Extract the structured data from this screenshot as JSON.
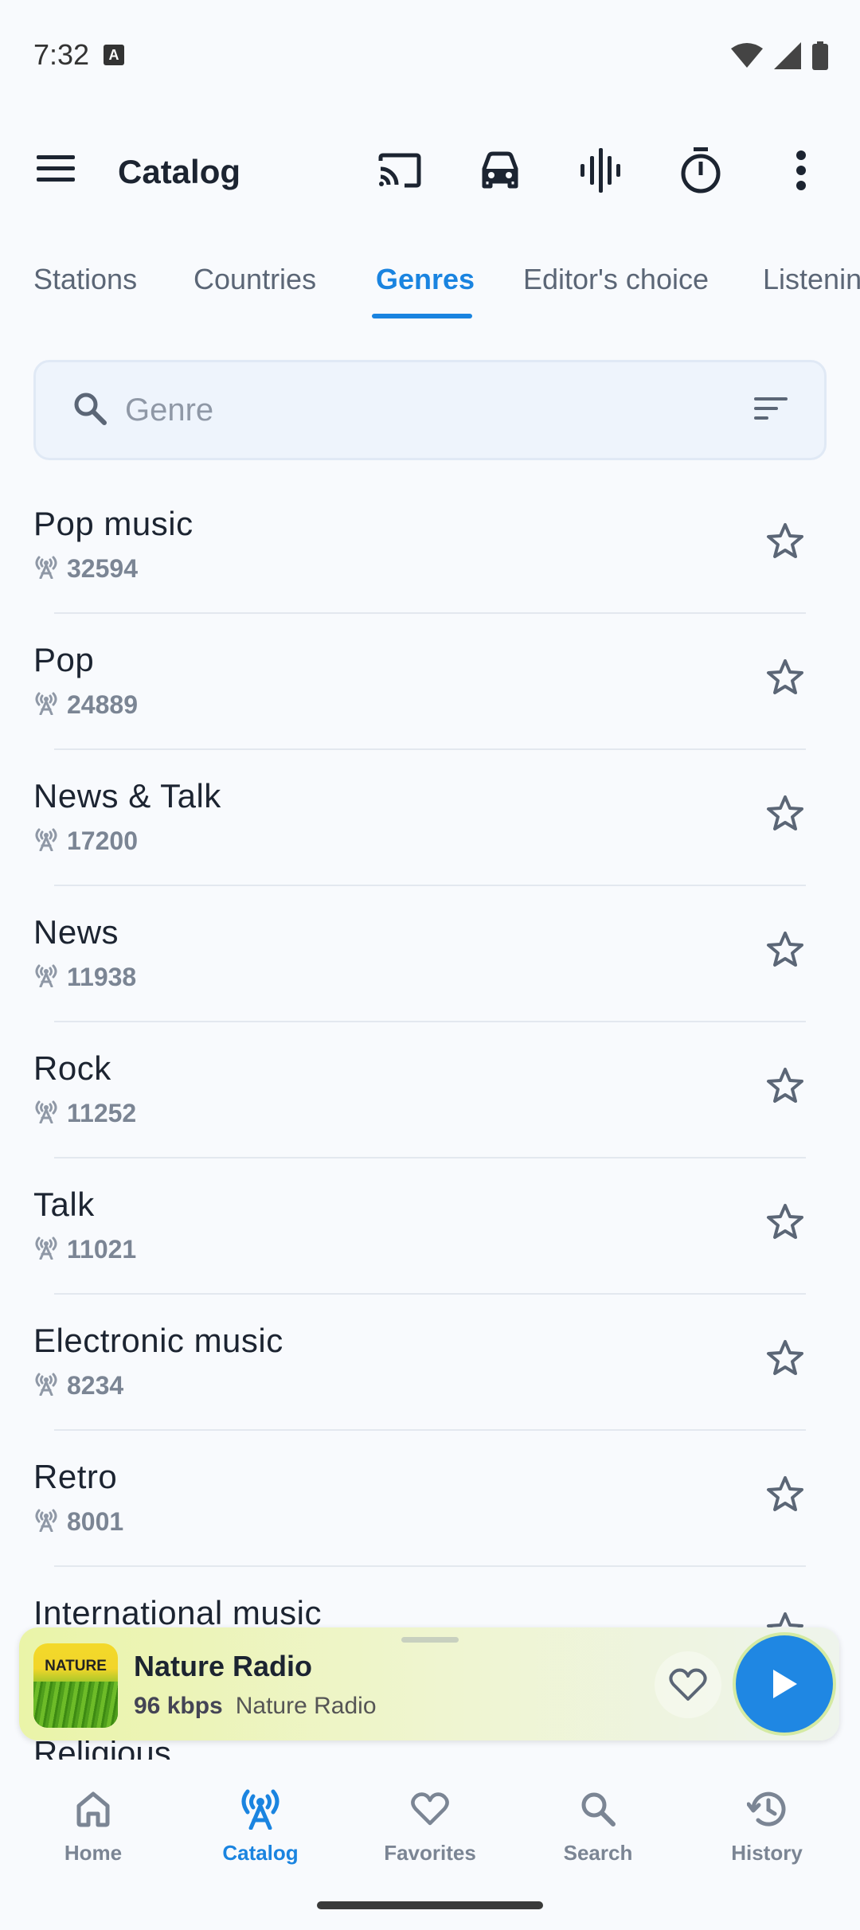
{
  "status_bar": {
    "time": "7:32",
    "badge": "A"
  },
  "toolbar": {
    "title": "Catalog",
    "icons": [
      "menu-icon",
      "cast-icon",
      "car-icon",
      "waveform-icon",
      "timer-icon",
      "more-vert-icon"
    ]
  },
  "tabs": [
    {
      "label": "Stations",
      "active": false
    },
    {
      "label": "Countries",
      "active": false
    },
    {
      "label": "Genres",
      "active": true
    },
    {
      "label": "Editor's choice",
      "active": false
    },
    {
      "label": "Listening",
      "active": false
    }
  ],
  "search": {
    "placeholder": "Genre",
    "value": ""
  },
  "genres": [
    {
      "name": "Pop music",
      "count": "32594"
    },
    {
      "name": "Pop",
      "count": "24889"
    },
    {
      "name": "News & Talk",
      "count": "17200"
    },
    {
      "name": "News",
      "count": "11938"
    },
    {
      "name": "Rock",
      "count": "11252"
    },
    {
      "name": "Talk",
      "count": "11021"
    },
    {
      "name": "Electronic music",
      "count": "8234"
    },
    {
      "name": "Retro",
      "count": "8001"
    },
    {
      "name": "International music",
      "count": ""
    },
    {
      "name": "Religious",
      "count": ""
    }
  ],
  "player": {
    "art_label": "NATURE",
    "title": "Nature Radio",
    "bitrate": "96 kbps",
    "station": "Nature Radio"
  },
  "bottom_nav": [
    {
      "label": "Home",
      "icon": "home-icon",
      "active": false
    },
    {
      "label": "Catalog",
      "icon": "antenna-icon",
      "active": true
    },
    {
      "label": "Favorites",
      "icon": "heart-icon",
      "active": false
    },
    {
      "label": "Search",
      "icon": "search-icon",
      "active": false
    },
    {
      "label": "History",
      "icon": "history-icon",
      "active": false
    }
  ],
  "colors": {
    "accent": "#1a84e0",
    "text": "#1c2431",
    "muted": "#7b8594",
    "background": "#f8fafd"
  }
}
